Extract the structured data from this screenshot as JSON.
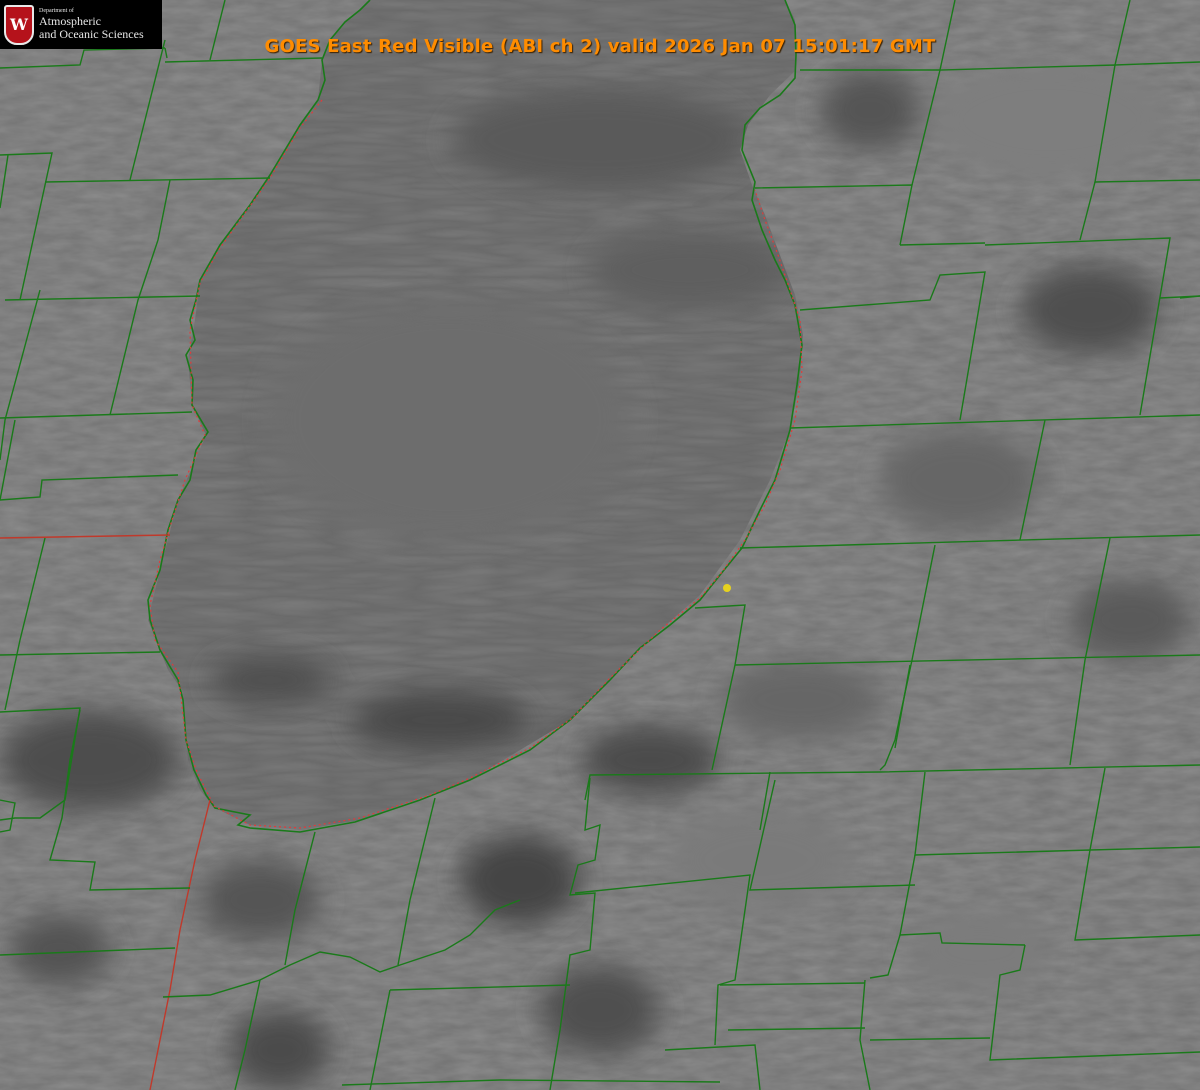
{
  "title": "GOES East Red Visible (ABI ch 2) valid 2026 Jan 07 15:01:17 GMT",
  "logo": {
    "emblem_letter": "W",
    "department": "Department of",
    "line1": "Atmospheric",
    "line2": "and Oceanic Sciences"
  },
  "colors": {
    "title": "#ff8c00",
    "county_borders": "#1a7a1a",
    "state_border": "#c0392b",
    "lake_outline_dotted": "#e23a3a",
    "station_marker": "#e6d21f",
    "background_imagery": "#6f6f6f",
    "logo_crest": "#b5121b"
  },
  "map": {
    "projection_view": "Lake Michigan region",
    "features": [
      "lake-michigan",
      "county-borders",
      "state-border",
      "station-marker"
    ]
  }
}
